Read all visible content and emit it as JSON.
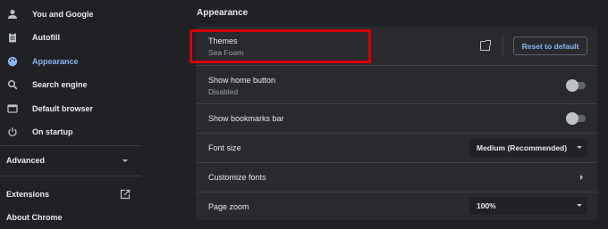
{
  "sidebar": {
    "items": [
      {
        "label": "You and Google",
        "icon": "person-icon"
      },
      {
        "label": "Autofill",
        "icon": "clipboard-icon"
      },
      {
        "label": "Appearance",
        "icon": "palette-icon"
      },
      {
        "label": "Search engine",
        "icon": "search-icon"
      },
      {
        "label": "Default browser",
        "icon": "browser-icon"
      },
      {
        "label": "On startup",
        "icon": "power-icon"
      }
    ],
    "advanced": "Advanced",
    "extensions": "Extensions",
    "about": "About Chrome"
  },
  "main": {
    "section_title": "Appearance",
    "themes": {
      "title": "Themes",
      "value": "Sea Foam",
      "reset_label": "Reset to default"
    },
    "home_button": {
      "title": "Show home button",
      "sub": "Disabled"
    },
    "bookmarks_bar": {
      "title": "Show bookmarks bar"
    },
    "font_size": {
      "title": "Font size",
      "value": "Medium (Recommended)"
    },
    "customize_fonts": {
      "title": "Customize fonts"
    },
    "page_zoom": {
      "title": "Page zoom",
      "value": "100%"
    }
  },
  "colors": {
    "accent": "#8ab4f8",
    "highlight": "#d50000",
    "background": "#202124",
    "card": "#292a2d"
  }
}
